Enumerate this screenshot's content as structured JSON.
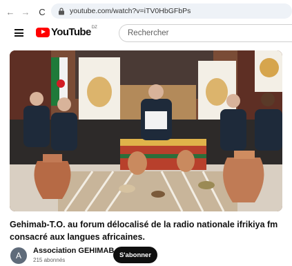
{
  "browser": {
    "url": "youtube.com/watch?v=iTV0HbGFbPs",
    "back_glyph": "←",
    "forward_glyph": "→",
    "reload_glyph": "C"
  },
  "header": {
    "logo_text": "YouTube",
    "country_code": "DZ",
    "search_placeholder": "Rechercher"
  },
  "video": {
    "title": "Gehimab-T.O. au forum délocalisé de la radio nationale ifrikiya fm consacré aux langues africaines.",
    "scene_colors": {
      "curtain": "#6a3d2c",
      "wall": "#a67a52",
      "floor": "#d9cfc2",
      "sofa": "#2d2a29",
      "rug": "#c8b59a",
      "banner": "#f3efe6"
    }
  },
  "channel": {
    "avatar_letter": "A",
    "name": "Association GEHIMAB",
    "subscribers": "215 abonnés",
    "subscribe_label": "S'abonner"
  }
}
